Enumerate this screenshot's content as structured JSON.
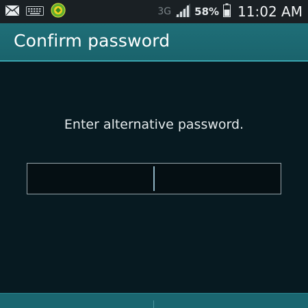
{
  "status_bar": {
    "icons_left": [
      "mail-icon",
      "keyboard-icon",
      "app-notification-icon"
    ],
    "network_type": "3G",
    "signal_icon": "signal-strength-icon",
    "battery_percent": "58%",
    "battery_icon": "battery-icon",
    "time": "11:02 AM"
  },
  "action_bar": {
    "title": "Confirm password"
  },
  "content": {
    "prompt": "Enter alternative password.",
    "password_value": "",
    "password_placeholder": ""
  },
  "colors": {
    "status_bar_bg": "#1a2024",
    "action_bar_bg": "#1f6f78",
    "action_bar_accent": "#3aa6b0",
    "screen_bg": "#071a21",
    "input_border": "#9aa8ae",
    "cursor": "#8fb4c4"
  }
}
